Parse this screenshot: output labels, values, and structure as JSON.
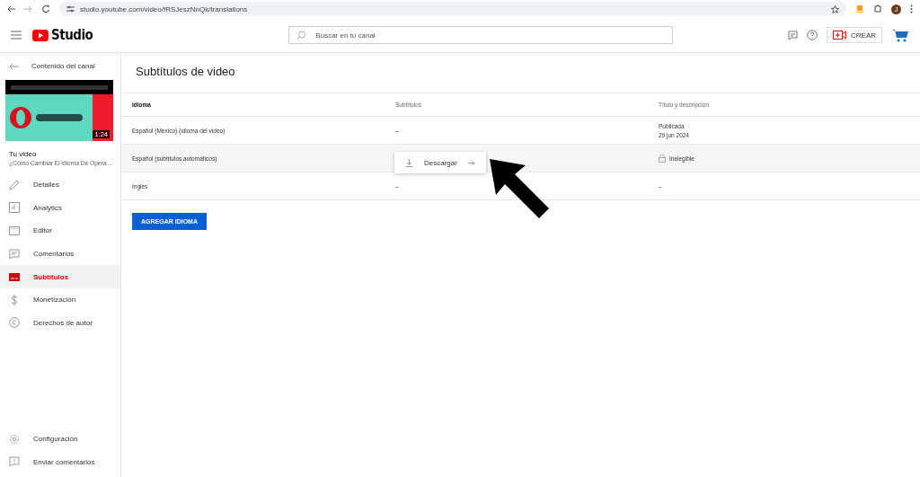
{
  "browser": {
    "url": "studio.youtube.com/video/fRSJeszNnQk/translations",
    "avatar": "J"
  },
  "header": {
    "logo": "Studio",
    "search": {
      "placeholder": "Buscar en tu canal"
    },
    "create": "CREAR"
  },
  "sidebar": {
    "back": "Contenido del canal",
    "thumbnail": {
      "kind": "picture",
      "duration": "1:24"
    },
    "your_video": "Tu video",
    "video_title": "¿Cómo Cambiar El Idioma De Opera ...",
    "items": [
      {
        "kind": "details",
        "label": "Detalles",
        "selected": false
      },
      {
        "kind": "analytics",
        "label": "Analytics",
        "selected": false
      },
      {
        "kind": "editor",
        "label": "Editor",
        "selected": false
      },
      {
        "kind": "comments",
        "label": "Comentarios",
        "selected": false
      },
      {
        "kind": "subtitles",
        "label": "Subtítulos",
        "selected": true
      },
      {
        "kind": "money",
        "label": "Monetización",
        "selected": false
      },
      {
        "kind": "copyright",
        "label": "Derechos de autor",
        "selected": false
      }
    ],
    "bottom": [
      {
        "kind": "settings",
        "label": "Configuración"
      },
      {
        "kind": "feedback",
        "label": "Enviar comentarios"
      }
    ]
  },
  "page": {
    "title": "Subtítulos de video",
    "columns": [
      "Idioma",
      "Subtítulos",
      "Título y descripción"
    ],
    "rows": [
      {
        "language": "Español (México) (idioma del video)",
        "subtitles": "–",
        "title_status": "Publicada",
        "title_date": "29 jun 2024"
      },
      {
        "language": "Español (subtítulos automáticos)",
        "title_status": "Inelegible",
        "locked": true,
        "menu": {
          "label": "Descargar"
        }
      },
      {
        "language": "Inglés",
        "subtitles": "–",
        "title_status": "–"
      }
    ],
    "add_button": "AGREGAR IDIOMA"
  }
}
